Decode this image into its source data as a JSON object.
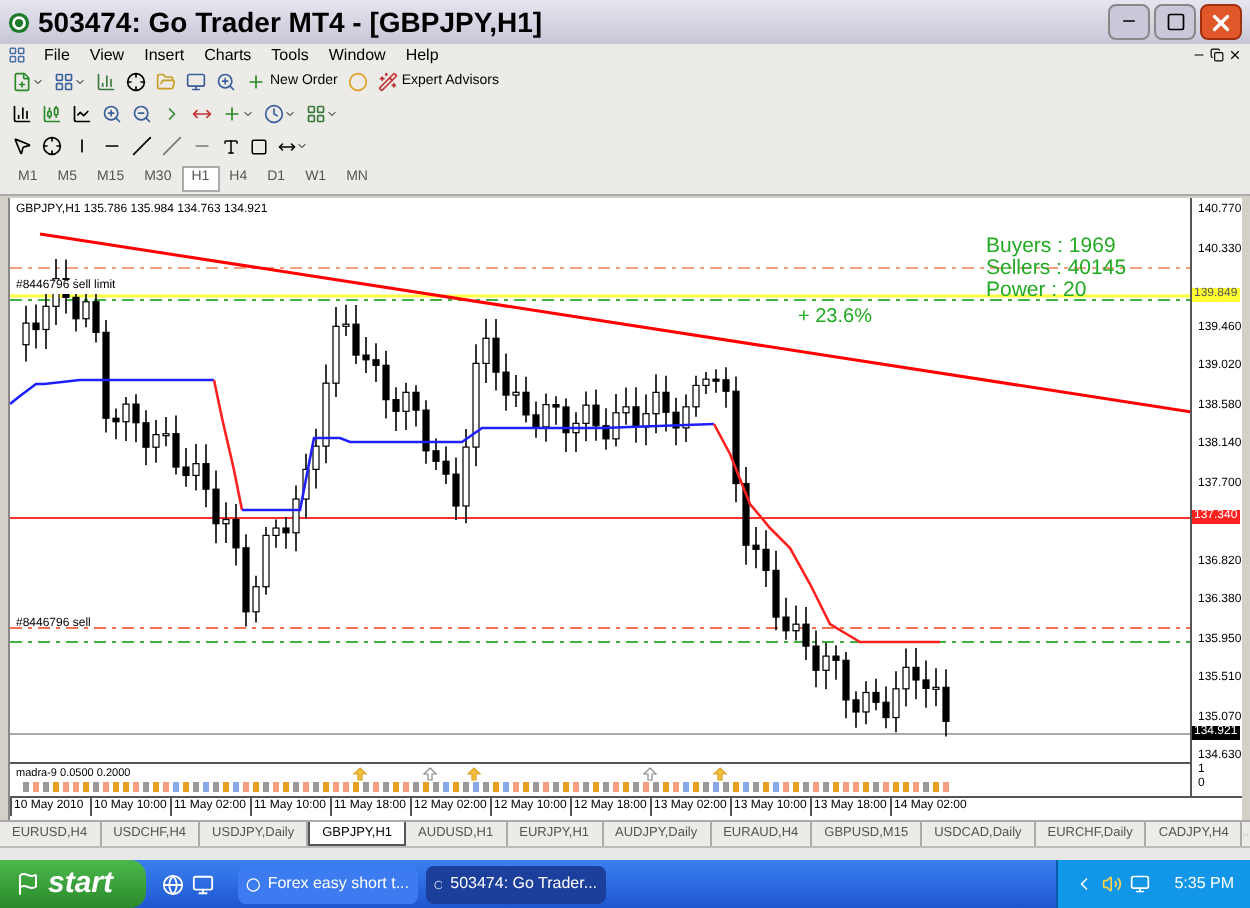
{
  "window": {
    "title": "503474: Go Trader MT4 - [GBPJPY,H1]"
  },
  "menu": [
    "File",
    "View",
    "Insert",
    "Charts",
    "Tools",
    "Window",
    "Help"
  ],
  "toolbar": {
    "new_order": "New Order",
    "expert_advisors": "Expert Advisors"
  },
  "timeframes": [
    {
      "label": "M1",
      "selected": false
    },
    {
      "label": "M5",
      "selected": false
    },
    {
      "label": "M15",
      "selected": false
    },
    {
      "label": "M30",
      "selected": false
    },
    {
      "label": "H1",
      "selected": true
    },
    {
      "label": "H4",
      "selected": false
    },
    {
      "label": "D1",
      "selected": false
    },
    {
      "label": "W1",
      "selected": false
    },
    {
      "label": "MN",
      "selected": false
    }
  ],
  "chart": {
    "header": "GBPJPY,H1  135.786 135.984 134.763 134.921",
    "fib_label": "+ 23.6%",
    "stats": [
      "Buyers : 1969",
      "Sellers : 40145",
      "Power : 20"
    ],
    "order_labels": [
      "#8446796 sell limit",
      "#8446796 sell"
    ],
    "price_labels": [
      "140.770",
      "140.330",
      "139.460",
      "139.020",
      "138.580",
      "138.140",
      "137.700",
      "136.820",
      "136.380",
      "135.950",
      "135.510",
      "135.070",
      "134.630"
    ],
    "markers": [
      {
        "kind": "yellow",
        "text": "139.849"
      },
      {
        "kind": "red",
        "text": "137.340"
      },
      {
        "kind": "bid",
        "text": "134.921"
      }
    ],
    "indicator_label": "madra-9 0.0500 0.2000",
    "indicator_scale": [
      "1",
      "0"
    ],
    "time_labels": [
      "10 May 2010",
      "10 May 10:00",
      "11 May 02:00",
      "11 May 10:00",
      "11 May 18:00",
      "12 May 02:00",
      "12 May 10:00",
      "12 May 18:00",
      "13 May 02:00",
      "13 May 10:00",
      "13 May 18:00",
      "14 May 02:00"
    ]
  },
  "tabs": [
    {
      "label": "EURUSD,H4",
      "selected": false
    },
    {
      "label": "USDCHF,H4",
      "selected": false
    },
    {
      "label": "USDJPY,Daily",
      "selected": false
    },
    {
      "label": "GBPJPY,H1",
      "selected": true
    },
    {
      "label": "AUDUSD,H1",
      "selected": false
    },
    {
      "label": "EURJPY,H1",
      "selected": false
    },
    {
      "label": "AUDJPY,Daily",
      "selected": false
    },
    {
      "label": "EURAUD,H4",
      "selected": false
    },
    {
      "label": "GBPUSD,M15",
      "selected": false
    },
    {
      "label": "USDCAD,Daily",
      "selected": false
    },
    {
      "label": "EURCHF,Daily",
      "selected": false
    },
    {
      "label": "CADJPY,H4",
      "selected": false
    }
  ],
  "taskbar": {
    "start": "start",
    "tasks": [
      {
        "label": "Forex easy short t...",
        "selected": false
      },
      {
        "label": "503474: Go Trader...",
        "selected": true
      }
    ],
    "clock": "5:35 PM"
  }
}
